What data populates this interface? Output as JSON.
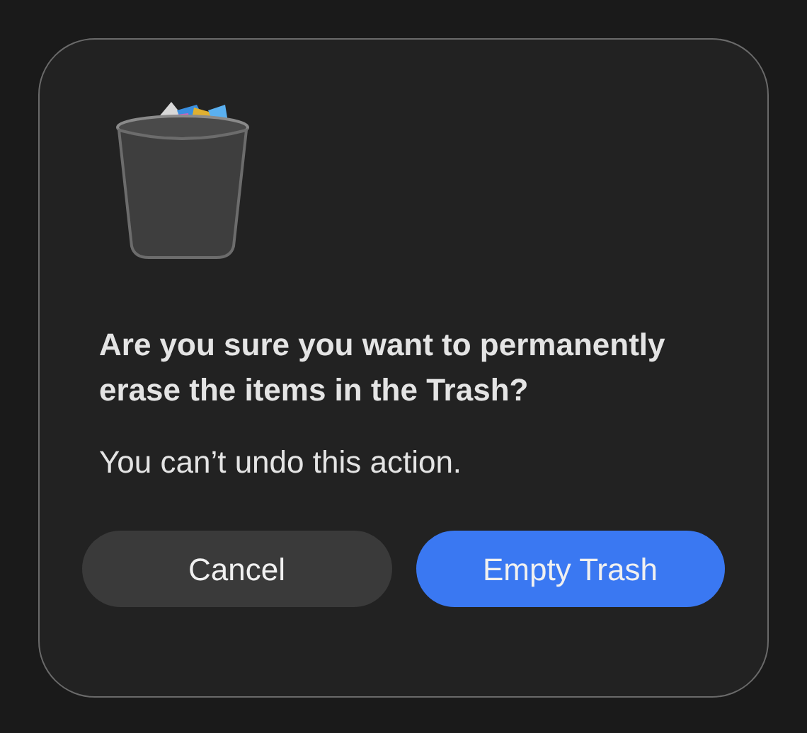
{
  "dialog": {
    "title": "Are you sure you want to permanently erase the items in the Trash?",
    "message": "You can’t undo this action.",
    "buttons": [
      {
        "label": "Cancel",
        "kind": "secondary"
      },
      {
        "label": "Empty Trash",
        "kind": "primary"
      }
    ]
  }
}
